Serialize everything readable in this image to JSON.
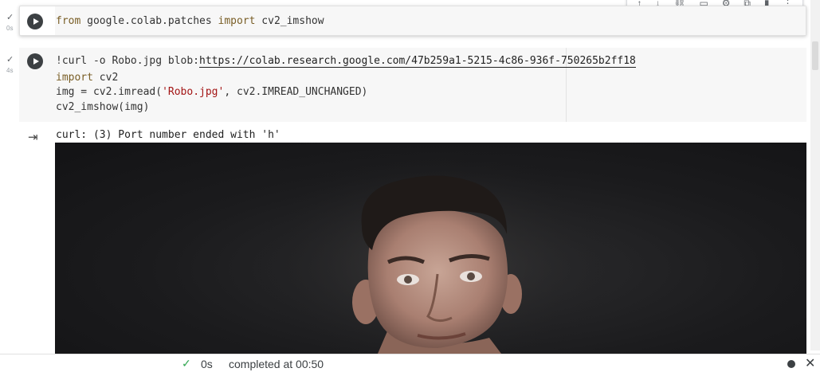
{
  "toolbar": {
    "icons": [
      "arrow-up-icon",
      "arrow-down-icon",
      "link-icon",
      "comment-icon",
      "gear-icon",
      "mirror-cell-icon",
      "delete-icon",
      "more-icon"
    ],
    "glyphs": [
      "↑",
      "↓",
      "⛓",
      "▭",
      "⚙",
      "⧉",
      "▮",
      "⋮"
    ]
  },
  "cell1": {
    "status_time": "0s",
    "code": {
      "kw_from": "from",
      "module": " google.colab.patches ",
      "kw_import": "import",
      "name": " cv2_imshow"
    }
  },
  "cell2": {
    "status_time": "4s",
    "line1_prefix": "!curl -o Robo.jpg blob:",
    "line1_url": "https://colab.research.google.com/47b259a1-5215-4c86-936f-750265b2ff18",
    "line2_kw": "import",
    "line2_rest": " cv2",
    "line3_prefix": "img = cv2.imread(",
    "line3_str": "'Robo.jpg'",
    "line3_suffix": ", cv2.IMREAD_UNCHANGED)",
    "line4": "cv2_imshow(img)"
  },
  "output": {
    "text": "curl: (3) Port number ended with 'h'"
  },
  "status_bar": {
    "check": "✓",
    "time": "0s",
    "message": "completed at 00:50",
    "close": "✕"
  },
  "colors": {
    "accent_green": "#34a853",
    "run_button": "#3c4043",
    "keyword": "#795e26",
    "string": "#a31515"
  }
}
